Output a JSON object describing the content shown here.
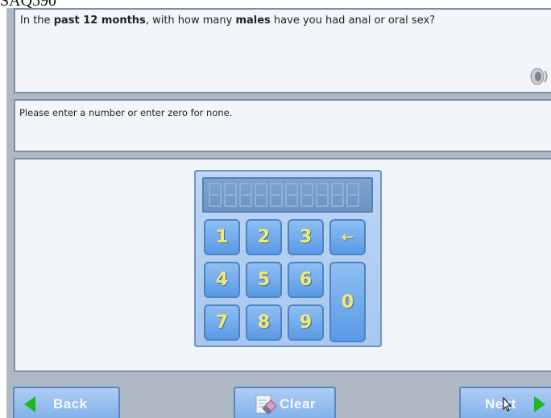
{
  "page_label": "SAQ590",
  "question": {
    "prefix": "In the ",
    "bold1": "past 12 months",
    "middle": ", with how many ",
    "bold2": "males",
    "suffix": " have you had anal or oral sex?"
  },
  "instruction": "Please enter a number or enter zero for none.",
  "keypad": {
    "keys": [
      "1",
      "2",
      "3",
      "←",
      "4",
      "5",
      "6",
      "0",
      "7",
      "8",
      "9"
    ],
    "display_value": ""
  },
  "buttons": {
    "back": "Back",
    "clear": "Clear",
    "next": "Next"
  },
  "colors": {
    "panel_bg": "#f2f6fb",
    "frame_bg": "#aeb9c4",
    "key_text": "#f6ea6d",
    "arrow_green": "#1fb81f"
  },
  "icons": {
    "audio": "speaker-icon",
    "clear": "eraser-icon",
    "back": "triangle-left-icon",
    "next": "triangle-right-icon"
  }
}
